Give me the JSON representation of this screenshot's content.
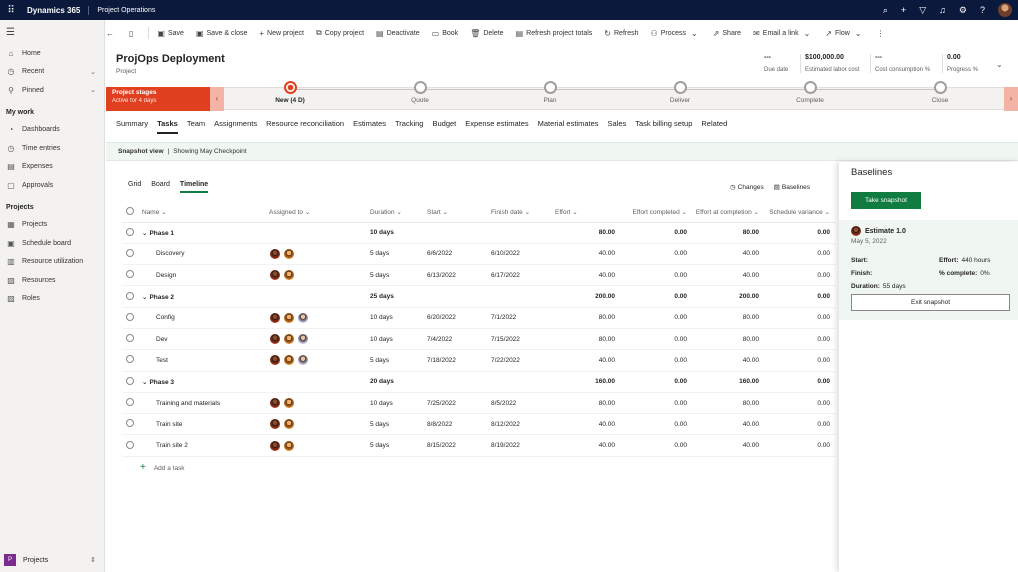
{
  "topbar": {
    "brand": "Dynamics 365",
    "app": "Project Operations",
    "icons": [
      "lightbulb-icon",
      "plus-icon",
      "filter-icon",
      "bell-icon",
      "gear-icon",
      "help-icon"
    ]
  },
  "sidebar": {
    "items": [
      {
        "label": "Home",
        "icon": "home-icon"
      },
      {
        "label": "Recent",
        "icon": "clock-icon"
      },
      {
        "label": "Pinned",
        "icon": "pin-icon"
      }
    ],
    "my_work_header": "My work",
    "my_work": [
      {
        "label": "Dashboards",
        "icon": "dashboard-icon"
      },
      {
        "label": "Time entries",
        "icon": "clock-icon"
      },
      {
        "label": "Expenses",
        "icon": "expense-icon"
      },
      {
        "label": "Approvals",
        "icon": "approval-icon"
      }
    ],
    "projects_header": "Projects",
    "projects": [
      {
        "label": "Projects",
        "icon": "projects-icon"
      },
      {
        "label": "Schedule board",
        "icon": "calendar-icon"
      },
      {
        "label": "Resource utilization",
        "icon": "utilization-icon"
      },
      {
        "label": "Resources",
        "icon": "resources-icon"
      },
      {
        "label": "Roles",
        "icon": "roles-icon"
      }
    ],
    "area_badge": "P",
    "area": "Projects"
  },
  "commands": {
    "save": "Save",
    "save_close": "Save & close",
    "new_project": "New project",
    "copy_project": "Copy project",
    "deactivate": "Deactivate",
    "book": "Book",
    "delete": "Delete",
    "refresh_totals": "Refresh project totals",
    "refresh": "Refresh",
    "process": "Process",
    "share": "Share",
    "email_link": "Email a link",
    "flow": "Flow"
  },
  "header": {
    "title": "ProjOps Deployment",
    "subtitle": "Project",
    "fields": [
      {
        "value": "---",
        "label": "Due date"
      },
      {
        "value": "$100,000.00",
        "label": "Estimated labor cost"
      },
      {
        "value": "---",
        "label": "Cost consumption %"
      },
      {
        "value": "0.00",
        "label": "Progress %"
      }
    ]
  },
  "bpf": {
    "active_title": "Project stages",
    "active_sub": "Active for 4 days",
    "stages": [
      "New (4 D)",
      "Quote",
      "Plan",
      "Deliver",
      "Complete",
      "Close"
    ]
  },
  "tabs": [
    "Summary",
    "Tasks",
    "Team",
    "Assignments",
    "Resource reconciliation",
    "Estimates",
    "Tracking",
    "Budget",
    "Expense estimates",
    "Material estimates",
    "Sales",
    "Task billing setup",
    "Related"
  ],
  "active_tab": "Tasks",
  "snapshot_banner": {
    "label": "Snapshot view",
    "sep": "|",
    "text": "Showing May Checkpoint"
  },
  "view_tabs": [
    "Grid",
    "Board",
    "Timeline"
  ],
  "grid_tools": {
    "changes": "Changes",
    "baselines": "Baselines"
  },
  "columns": [
    "Name",
    "Assigned to",
    "Duration",
    "Start",
    "Finish date",
    "Effort",
    "Effort completed",
    "Effort at completion",
    "Schedule variance"
  ],
  "rows": [
    {
      "phase": true,
      "name": "Phase 1",
      "duration": "10 days",
      "start": "",
      "finish": "",
      "effort": "80.00",
      "completed": "0.00",
      "at_completion": "80.00",
      "variance": "0.00",
      "avatars": []
    },
    {
      "phase": false,
      "name": "Discovery",
      "duration": "5 days",
      "start": "6/6/2022",
      "finish": "6/10/2022",
      "effort": "40.00",
      "completed": "0.00",
      "at_completion": "40.00",
      "variance": "0.00",
      "avatars": [
        "av1",
        "av2"
      ]
    },
    {
      "phase": false,
      "name": "Design",
      "duration": "5 days",
      "start": "6/13/2022",
      "finish": "6/17/2022",
      "effort": "40.00",
      "completed": "0.00",
      "at_completion": "40.00",
      "variance": "0.00",
      "avatars": [
        "av1",
        "av2"
      ]
    },
    {
      "phase": true,
      "name": "Phase 2",
      "duration": "25 days",
      "start": "",
      "finish": "",
      "effort": "200.00",
      "completed": "0.00",
      "at_completion": "200.00",
      "variance": "0.00",
      "avatars": []
    },
    {
      "phase": false,
      "name": "Config",
      "duration": "10 days",
      "start": "6/20/2022",
      "finish": "7/1/2022",
      "effort": "80.00",
      "completed": "0.00",
      "at_completion": "80.00",
      "variance": "0.00",
      "avatars": [
        "av1",
        "av2",
        "av3"
      ]
    },
    {
      "phase": false,
      "name": "Dev",
      "duration": "10 days",
      "start": "7/4/2022",
      "finish": "7/15/2022",
      "effort": "80.00",
      "completed": "0.00",
      "at_completion": "80.00",
      "variance": "0.00",
      "avatars": [
        "av1",
        "av2",
        "av3"
      ]
    },
    {
      "phase": false,
      "name": "Test",
      "duration": "5 days",
      "start": "7/18/2022",
      "finish": "7/22/2022",
      "effort": "40.00",
      "completed": "0.00",
      "at_completion": "40.00",
      "variance": "0.00",
      "avatars": [
        "av1",
        "av2",
        "av3"
      ]
    },
    {
      "phase": true,
      "name": "Phase 3",
      "duration": "20 days",
      "start": "",
      "finish": "",
      "effort": "160.00",
      "completed": "0.00",
      "at_completion": "160.00",
      "variance": "0.00",
      "avatars": []
    },
    {
      "phase": false,
      "name": "Training and materials",
      "duration": "10 days",
      "start": "7/25/2022",
      "finish": "8/5/2022",
      "effort": "80.00",
      "completed": "0.00",
      "at_completion": "80.00",
      "variance": "0.00",
      "avatars": [
        "av1",
        "av2"
      ]
    },
    {
      "phase": false,
      "name": "Train site",
      "duration": "5 days",
      "start": "8/8/2022",
      "finish": "8/12/2022",
      "effort": "40.00",
      "completed": "0.00",
      "at_completion": "40.00",
      "variance": "0.00",
      "avatars": [
        "av1",
        "av2"
      ]
    },
    {
      "phase": false,
      "name": "Train site 2",
      "duration": "5 days",
      "start": "8/15/2022",
      "finish": "8/19/2022",
      "effort": "40.00",
      "completed": "0.00",
      "at_completion": "40.00",
      "variance": "0.00",
      "avatars": [
        "av1",
        "av2"
      ]
    }
  ],
  "add_task": "Add a task",
  "baselines": {
    "title": "Baselines",
    "take_snapshot": "Take snapshot",
    "card": {
      "name": "Estimate 1.0",
      "date": "May 5, 2022",
      "start_label": "Start:",
      "start_value": "",
      "effort_label": "Effort:",
      "effort_value": "440 hours",
      "finish_label": "Finish:",
      "finish_value": "",
      "complete_label": "% complete:",
      "complete_value": "0%",
      "duration_label": "Duration:",
      "duration_value": "55 days"
    },
    "exit_snapshot": "Exit snapshot"
  },
  "colors": {
    "accent": "#107c41",
    "stage_active": "#e0401f",
    "topbar": "#0b1a3c"
  }
}
